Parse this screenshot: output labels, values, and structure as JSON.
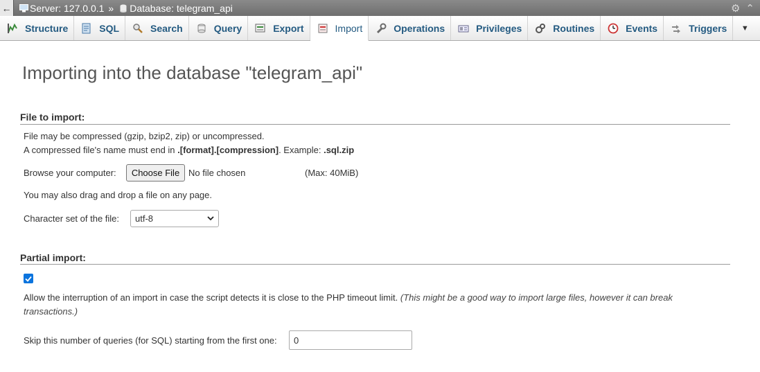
{
  "breadcrumb": {
    "server": "Server: 127.0.0.1",
    "separator": "»",
    "database": "Database: telegram_api"
  },
  "tabs": [
    {
      "label": "Structure",
      "icon": "structure-icon"
    },
    {
      "label": "SQL",
      "icon": "sql-icon"
    },
    {
      "label": "Search",
      "icon": "search-icon"
    },
    {
      "label": "Query",
      "icon": "query-icon"
    },
    {
      "label": "Export",
      "icon": "export-icon"
    },
    {
      "label": "Import",
      "icon": "import-icon",
      "active": true
    },
    {
      "label": "Operations",
      "icon": "wrench-icon"
    },
    {
      "label": "Privileges",
      "icon": "privileges-icon"
    },
    {
      "label": "Routines",
      "icon": "routines-icon"
    },
    {
      "label": "Events",
      "icon": "clock-icon"
    },
    {
      "label": "Triggers",
      "icon": "triggers-icon"
    }
  ],
  "more_tab": "▼",
  "title": "Importing into the database \"telegram_api\"",
  "file_section": {
    "heading": "File to import:",
    "line1": "File may be compressed (gzip, bzip2, zip) or uncompressed.",
    "line2_prefix": "A compressed file's name must end in ",
    "line2_bold": ".[format].[compression]",
    "line2_mid": ". Example: ",
    "line2_example": ".sql.zip",
    "browse_label": "Browse your computer:",
    "choose_button": "Choose File",
    "no_file": "No file chosen",
    "max_size": "(Max: 40MiB)",
    "drag_note": "You may also drag and drop a file on any page.",
    "charset_label": "Character set of the file:",
    "charset_value": "utf-8"
  },
  "partial_section": {
    "heading": "Partial import:",
    "allow_checked": true,
    "allow_text": "Allow the interruption of an import in case the script detects it is close to the PHP timeout limit.",
    "allow_note_1": "(This might be a good way to import large files, however it can break",
    "allow_note_2": "transactions.)",
    "skip_label": "Skip this number of queries (for SQL) starting from the first one:",
    "skip_value": "0"
  },
  "colors": {
    "tab_text": "#235a81",
    "checkbox": "#0b74de",
    "breadcrumb_bg": "#7b7b7b"
  }
}
